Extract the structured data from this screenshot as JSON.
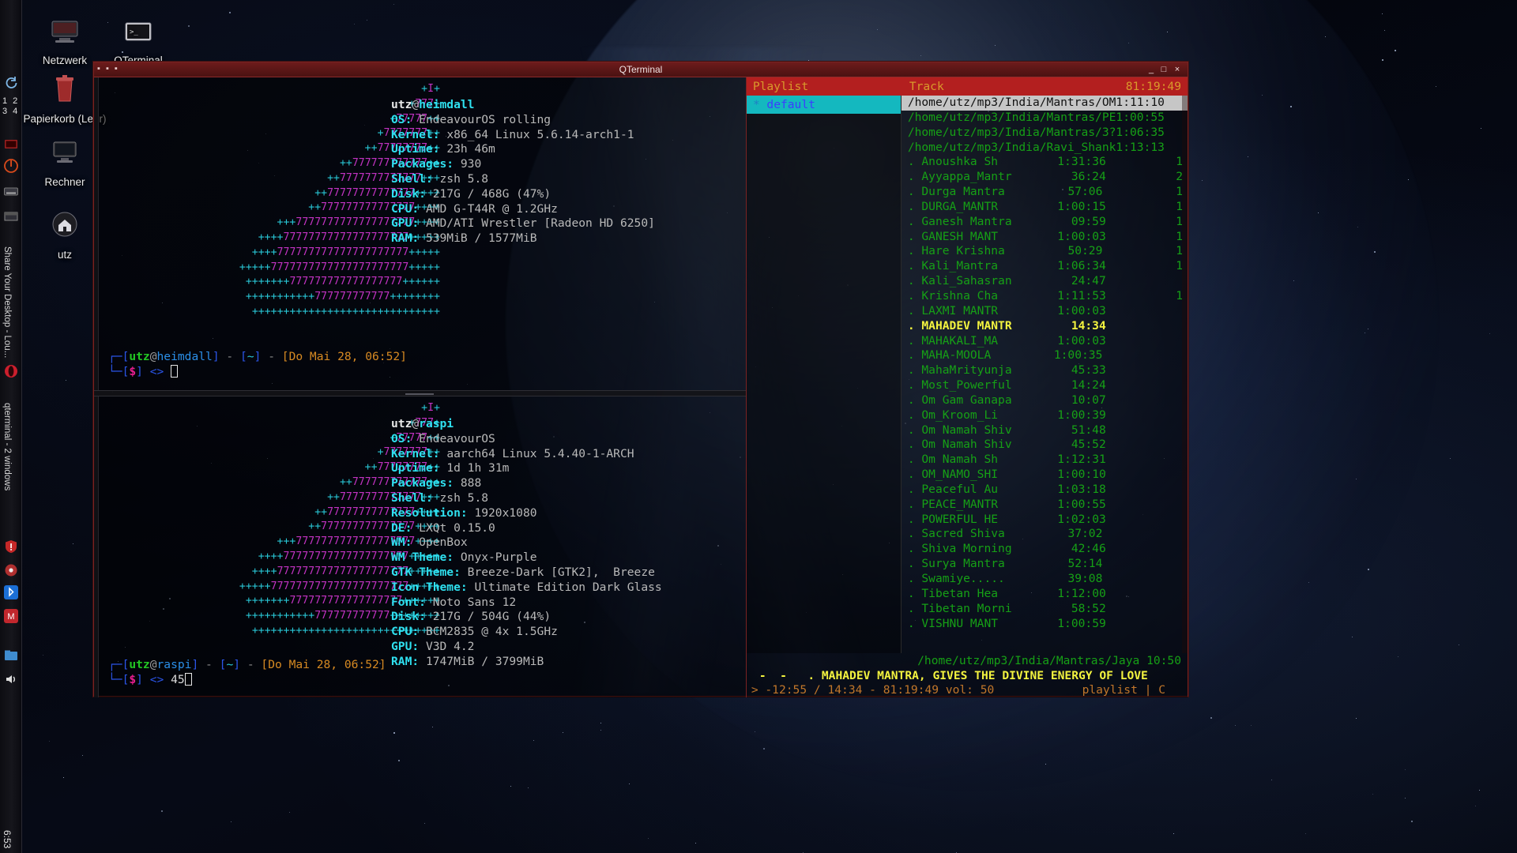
{
  "desktop": {
    "icons": [
      {
        "name": "Netzwerk",
        "glyph": "network-icon"
      },
      {
        "name": "QTerminal",
        "glyph": "terminal-icon"
      },
      {
        "name": "Papierkorb (Leer)",
        "glyph": "trash-icon"
      },
      {
        "name": "Rechner",
        "glyph": "computer-icon"
      },
      {
        "name": "utz",
        "glyph": "home-folder-icon"
      }
    ]
  },
  "leftpanel": {
    "desktops": "1 2 3 4",
    "share_label": "Share Your Desktop - Lou...",
    "tasklist_label": "qterminal - 2 windows",
    "clock": "6:53"
  },
  "window": {
    "title": "QTerminal",
    "minimize": "_",
    "maximize": "□",
    "close": "×"
  },
  "pane1": {
    "host_user": "utz",
    "host_sep": "@",
    "host_name": "heimdall",
    "fields": [
      {
        "key": "OS:",
        "value": "EndeavourOS rolling"
      },
      {
        "key": "Kernel:",
        "value": "x86_64 Linux 5.6.14-arch1-1"
      },
      {
        "key": "Uptime:",
        "value": "23h 46m"
      },
      {
        "key": "Packages:",
        "value": "930"
      },
      {
        "key": "Shell:",
        "value": "zsh 5.8"
      },
      {
        "key": "Disk:",
        "value": "217G / 468G (47%)"
      },
      {
        "key": "CPU:",
        "value": "AMD G-T44R @ 1.2GHz"
      },
      {
        "key": "GPU:",
        "value": "AMD/ATI Wrestler [Radeon HD 6250]"
      },
      {
        "key": "RAM:",
        "value": "539MiB / 1577MiB"
      }
    ],
    "prompt": {
      "user": "utz",
      "at": "@",
      "host": "heimdall",
      "path": "~",
      "date": "Do Mai 28, 06:52",
      "dollar": "$",
      "arrow": "<>",
      "typed": ""
    }
  },
  "pane2": {
    "host_user": "utz",
    "host_sep": "@",
    "host_name": "raspi",
    "fields": [
      {
        "key": "OS:",
        "value": "EndeavourOS"
      },
      {
        "key": "Kernel:",
        "value": "aarch64 Linux 5.4.40-1-ARCH"
      },
      {
        "key": "Uptime:",
        "value": "1d 1h 31m"
      },
      {
        "key": "Packages:",
        "value": "888"
      },
      {
        "key": "Shell:",
        "value": "zsh 5.8"
      },
      {
        "key": "Resolution:",
        "value": "1920x1080"
      },
      {
        "key": "DE:",
        "value": "LXQt 0.15.0"
      },
      {
        "key": "WM:",
        "value": "OpenBox"
      },
      {
        "key": "WM Theme:",
        "value": "Onyx-Purple"
      },
      {
        "key": "GTK Theme:",
        "value": "Breeze-Dark [GTK2],  Breeze"
      },
      {
        "key": "Icon Theme:",
        "value": "Ultimate Edition Dark Glass"
      },
      {
        "key": "Font:",
        "value": "Noto Sans 12"
      },
      {
        "key": "Disk:",
        "value": "217G / 504G (44%)"
      },
      {
        "key": "CPU:",
        "value": "BCM2835 @ 4x 1.5GHz"
      },
      {
        "key": "GPU:",
        "value": "V3D 4.2"
      },
      {
        "key": "RAM:",
        "value": "1747MiB / 3799MiB"
      }
    ],
    "prompt": {
      "user": "utz",
      "at": "@",
      "host": "raspi",
      "path": "~",
      "date": "Do Mai 28, 06:52",
      "dollar": "$",
      "arrow": "<>",
      "typed": "45"
    }
  },
  "cmus": {
    "header": {
      "playlist": "Playlist",
      "track": "Track",
      "total_time": "81:19:49"
    },
    "playlists": [
      {
        "marker": "*",
        "name": "default",
        "selected": true
      }
    ],
    "tracks": [
      {
        "name": "/home/utz/mp3/India/Mantras/OM",
        "time": "1:11:10",
        "type": "path",
        "selected": true
      },
      {
        "name": "/home/utz/mp3/India/Mantras/PE",
        "time": "1:00:55",
        "type": "path"
      },
      {
        "name": "/home/utz/mp3/India/Mantras/3?",
        "time": "1:06:35",
        "type": "path"
      },
      {
        "name": "/home/utz/mp3/India/Ravi_Shank",
        "time": "1:13:13",
        "type": "path"
      },
      {
        "name": ". Anoushka Sh",
        "time": "1:31:36",
        "num": "1"
      },
      {
        "name": ". Ayyappa_Mantr",
        "time": "36:24",
        "num": "2"
      },
      {
        "name": ". Durga Mantra",
        "time": "57:06",
        "num": "1"
      },
      {
        "name": ". DURGA_MANTR",
        "time": "1:00:15",
        "num": "1"
      },
      {
        "name": ". Ganesh Mantra",
        "time": "09:59",
        "num": "1"
      },
      {
        "name": ". GANESH MANT",
        "time": "1:00:03",
        "num": "1"
      },
      {
        "name": ". Hare Krishna",
        "time": "50:29",
        "num": "1"
      },
      {
        "name": ". Kali_Mantra",
        "time": "1:06:34",
        "num": "1"
      },
      {
        "name": ". Kali_Sahasran",
        "time": "24:47",
        "num": ""
      },
      {
        "name": ". Krishna Cha",
        "time": "1:11:53",
        "num": "1"
      },
      {
        "name": ". LAXMI MANTR",
        "time": "1:00:03",
        "num": ""
      },
      {
        "name": ". MAHADEV MANTR",
        "time": "14:34",
        "num": "",
        "current": true
      },
      {
        "name": ". MAHAKALI_MA",
        "time": "1:00:03",
        "num": ""
      },
      {
        "name": ". MAHA-MOOLA",
        "time": "1:00:35",
        "num": ""
      },
      {
        "name": ". MahaMrityunja",
        "time": "45:33",
        "num": ""
      },
      {
        "name": ". Most_Powerful",
        "time": "14:24",
        "num": ""
      },
      {
        "name": ". Om Gam Ganapa",
        "time": "10:07",
        "num": ""
      },
      {
        "name": ". Om_Kroom_Li",
        "time": "1:00:39",
        "num": ""
      },
      {
        "name": ". Om Namah Shiv",
        "time": "51:48",
        "num": ""
      },
      {
        "name": ". Om Namah Shiv",
        "time": "45:52",
        "num": ""
      },
      {
        "name": ". Om Namah Sh",
        "time": "1:12:31",
        "num": ""
      },
      {
        "name": ". OM_NAMO_SHI",
        "time": "1:00:10",
        "num": ""
      },
      {
        "name": ". Peaceful Au",
        "time": "1:03:18",
        "num": ""
      },
      {
        "name": ". PEACE_MANTR",
        "time": "1:00:55",
        "num": ""
      },
      {
        "name": ". POWERFUL HE",
        "time": "1:02:03",
        "num": ""
      },
      {
        "name": ". Sacred Shiva",
        "time": "37:02",
        "num": ""
      },
      {
        "name": ". Shiva Morning",
        "time": "42:46",
        "num": ""
      },
      {
        "name": ". Surya Mantra",
        "time": "52:14",
        "num": ""
      },
      {
        "name": ". Swamiye.....",
        "time": "39:08",
        "num": ""
      },
      {
        "name": ". Tibetan Hea",
        "time": "1:12:00",
        "num": ""
      },
      {
        "name": ". Tibetan Morni",
        "time": "58:52",
        "num": ""
      },
      {
        "name": ". VISHNU MANT",
        "time": "1:00:59",
        "num": ""
      }
    ],
    "status": {
      "line1": "/home/utz/mp3/India/Mantras/Jaya 10:50",
      "now_playing": "-  -   . MAHADEV MANTRA, GIVES THE DIVINE ENERGY OF LOVE",
      "transport": "> -12:55 / 14:34 - 81:19:49 vol: 50",
      "mode": "playlist | C"
    }
  },
  "colors": {
    "accent_red": "#b31f1f",
    "cyan": "#2fe0ef",
    "green": "#16a016",
    "yellow": "#f3f33f",
    "orange": "#c1762a",
    "teal_sel": "#14b8bf"
  }
}
